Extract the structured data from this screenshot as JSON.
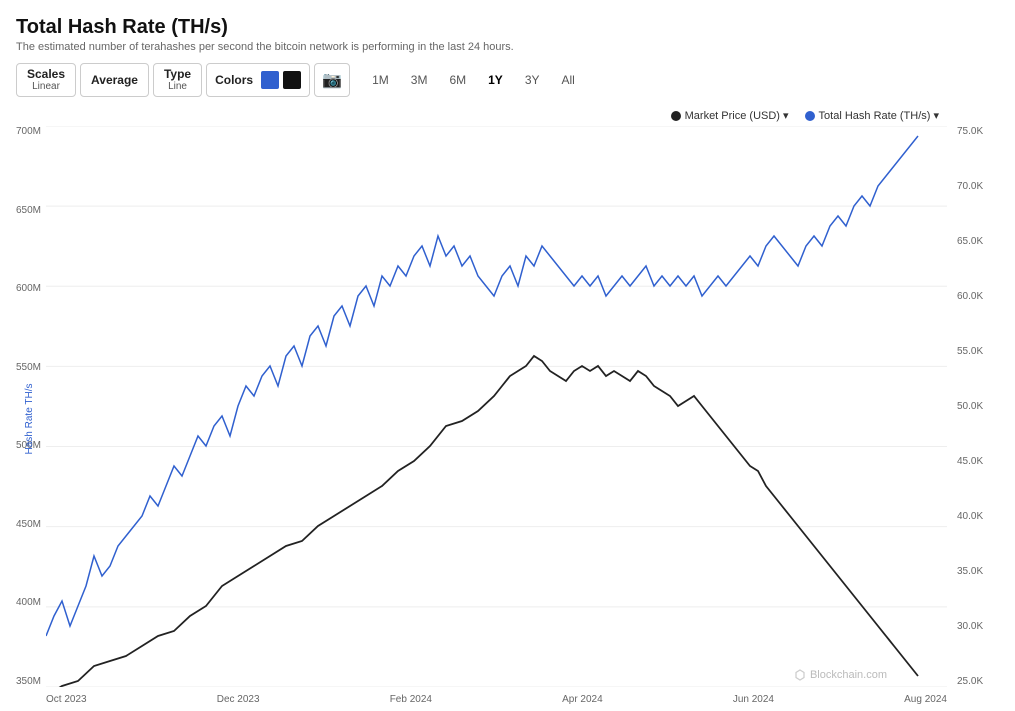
{
  "title": "Total Hash Rate (TH/s)",
  "subtitle": "The estimated number of terahashes per second the bitcoin network is performing in the last 24 hours.",
  "toolbar": {
    "scales_label": "Scales",
    "scales_value": "Linear",
    "average_label": "Average",
    "type_label": "Type",
    "type_value": "Line",
    "colors_label": "Colors",
    "color1": "#3060cf",
    "color2": "#111111"
  },
  "time_buttons": [
    "1M",
    "3M",
    "6M",
    "1Y",
    "3Y",
    "All"
  ],
  "active_time": "1Y",
  "legend": {
    "market_price": "Market Price (USD)",
    "hash_rate": "Total Hash Rate (TH/s)",
    "market_color": "#222",
    "hash_color": "#3060cf"
  },
  "y_axis_left": [
    "700M",
    "650M",
    "600M",
    "550M",
    "500M",
    "450M",
    "400M",
    "350M"
  ],
  "y_axis_right": [
    "75.0K",
    "70.0K",
    "65.0K",
    "60.0K",
    "55.0K",
    "50.0K",
    "45.0K",
    "40.0K",
    "35.0K",
    "30.0K",
    "25.0K"
  ],
  "x_axis": [
    "Oct 2023",
    "Dec 2023",
    "Feb 2024",
    "Apr 2024",
    "Jun 2024",
    "Aug 2024"
  ],
  "y_axis_left_label": "Hash Rate TH/s",
  "watermark": "Blockchain.com"
}
